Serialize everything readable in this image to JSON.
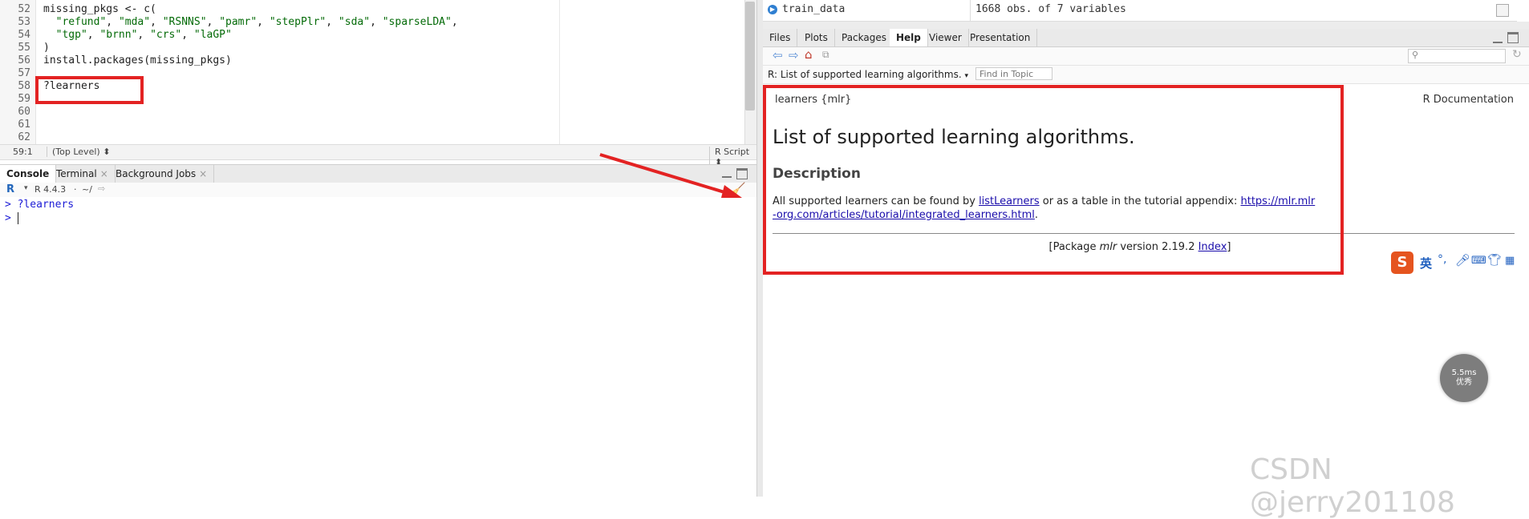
{
  "editor": {
    "lines": [
      {
        "num": "52",
        "text": "missing_pkgs <- c("
      },
      {
        "num": "53",
        "text": "  \"refund\", \"mda\", \"RSNNS\", \"pamr\", \"stepPlr\", \"sda\", \"sparseLDA\","
      },
      {
        "num": "54",
        "text": "  \"tgp\", \"brnn\", \"crs\", \"laGP\""
      },
      {
        "num": "55",
        "text": ")"
      },
      {
        "num": "56",
        "text": "install.packages(missing_pkgs)"
      },
      {
        "num": "57",
        "text": ""
      },
      {
        "num": "58",
        "text": "?learners"
      },
      {
        "num": "59",
        "text": ""
      },
      {
        "num": "60",
        "text": ""
      },
      {
        "num": "61",
        "text": ""
      },
      {
        "num": "62",
        "text": ""
      }
    ],
    "status": {
      "position": "59:1",
      "scope": "(Top Level)",
      "type": "R Script"
    }
  },
  "console": {
    "tabs": [
      {
        "label": "Console",
        "closable": false
      },
      {
        "label": "Terminal",
        "closable": true
      },
      {
        "label": "Background Jobs",
        "closable": true
      }
    ],
    "version": "R 4.4.3",
    "path": "~/",
    "lines": [
      "> ?learners",
      "> "
    ]
  },
  "environment": {
    "name": "train_data",
    "value": "1668 obs. of 7 variables"
  },
  "help": {
    "tabs": [
      "Files",
      "Plots",
      "Packages",
      "Help",
      "Viewer",
      "Presentation"
    ],
    "active_tab": "Help",
    "topic": "R: List of supported learning algorithms.",
    "find_placeholder": "Find in Topic",
    "header_left": "learners {mlr}",
    "header_right": "R Documentation",
    "title": "List of supported learning algorithms.",
    "desc_heading": "Description",
    "desc_text_1": "All supported learners can be found by ",
    "desc_link_1": "listLearners",
    "desc_text_2": " or as a table in the tutorial appendix: ",
    "desc_link_2": "https://mlr.mlr-org.com/articles/tutorial/integrated_learners.html",
    "desc_text_3": ".",
    "footer_pre": "[Package ",
    "footer_pkg": "mlr",
    "footer_mid": " version 2.19.2 ",
    "footer_link": "Index",
    "footer_post": "]"
  },
  "overlays": {
    "watermark": "CSDN @jerry201108",
    "latency_value": "5.5ms",
    "latency_label": "优秀",
    "ime_label": "英"
  },
  "colors": {
    "annotation_red": "#e32222",
    "link": "#1a0dab"
  }
}
